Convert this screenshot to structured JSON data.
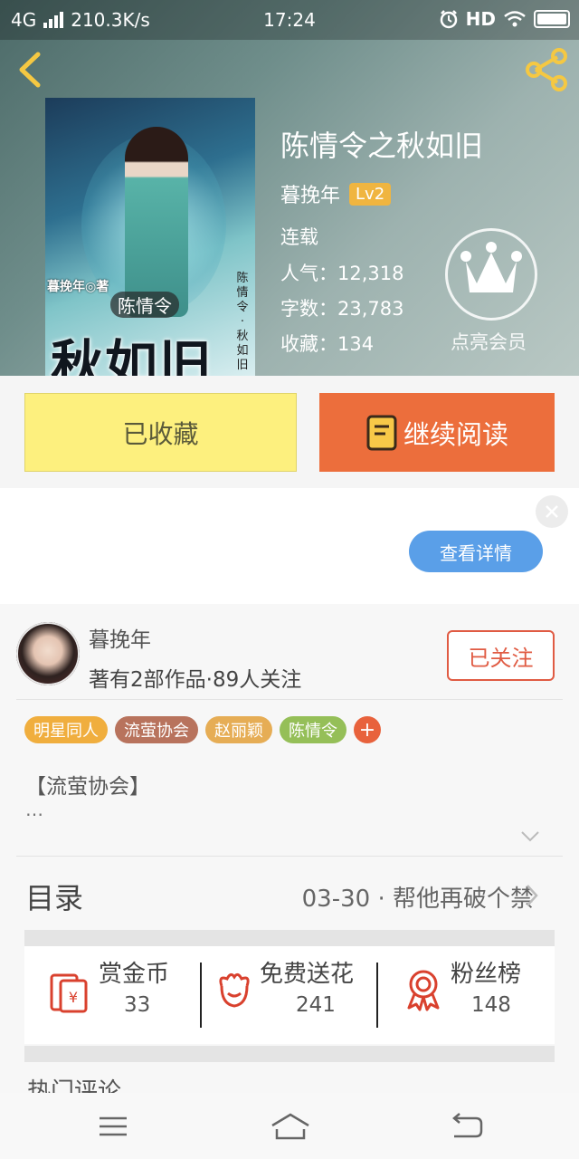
{
  "status_bar": {
    "network": "4G",
    "speed": "210.3K/s",
    "time": "17:24",
    "hd": "HD"
  },
  "header": {
    "back_icon": "chevron-left-icon",
    "share_icon": "share-icon"
  },
  "book": {
    "title": "陈情令之秋如旧",
    "author": "暮挽年",
    "level": "Lv2",
    "status": "连载",
    "popularity_label": "人气：",
    "popularity": "12,318",
    "words_label": "字数：",
    "words": "23,783",
    "favorites_label": "收藏：",
    "favorites": "134",
    "vip_label": "点亮会员",
    "cover": {
      "author_line": "暮挽年◎著",
      "small_title": "陈情令",
      "big_title": "秋如旧",
      "vertical_text": "陈情令·秋如旧"
    }
  },
  "actions": {
    "collected_label": "已收藏",
    "continue_label": "继续阅读"
  },
  "ad": {
    "detail_label": "查看详情"
  },
  "author_panel": {
    "name": "暮挽年",
    "summary": "著有2部作品·89人关注",
    "follow_label": "已关注"
  },
  "tags": [
    {
      "label": "明星同人",
      "color": "#f0ae3e"
    },
    {
      "label": "流萤协会",
      "color": "#b8735d"
    },
    {
      "label": "赵丽颖",
      "color": "#e6ad55"
    },
    {
      "label": "陈情令",
      "color": "#95bf58"
    }
  ],
  "tag_add": "+",
  "description": {
    "text": "【流萤协会】",
    "more": "…"
  },
  "toc": {
    "label": "目录",
    "latest": "03-30 · 帮他再破个禁"
  },
  "stats": [
    {
      "label": "赏金币",
      "value": "33",
      "icon": "red-envelope-icon"
    },
    {
      "label": "免费送花",
      "value": "241",
      "icon": "flower-icon"
    },
    {
      "label": "粉丝榜",
      "value": "148",
      "icon": "medal-icon"
    }
  ],
  "comments": {
    "partial": "热门评论"
  },
  "colors": {
    "accent_orange": "#ec6e3c",
    "collected_yellow": "#fdf07e",
    "follow_red": "#e05b43",
    "detail_blue": "#5a9fe8",
    "level_gold": "#f0b540"
  }
}
